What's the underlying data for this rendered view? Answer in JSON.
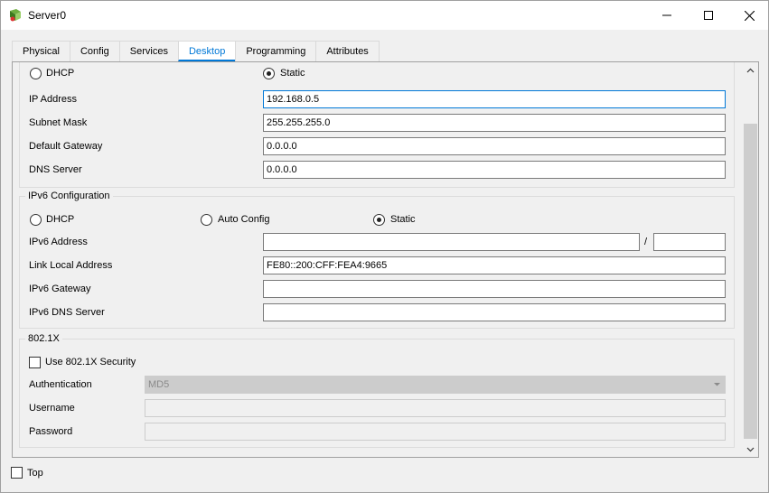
{
  "window": {
    "title": "Server0",
    "icon": "server-app-icon",
    "controls": [
      "minimize-icon",
      "maximize-icon",
      "close-icon"
    ]
  },
  "tabs": [
    {
      "label": "Physical",
      "active": false
    },
    {
      "label": "Config",
      "active": false
    },
    {
      "label": "Services",
      "active": false
    },
    {
      "label": "Desktop",
      "active": true
    },
    {
      "label": "Programming",
      "active": false
    },
    {
      "label": "Attributes",
      "active": false
    }
  ],
  "ipv4": {
    "dhcp_label": "DHCP",
    "static_label": "Static",
    "mode": "Static",
    "ip_address_label": "IP Address",
    "ip_address": "192.168.0.5",
    "subnet_label": "Subnet Mask",
    "subnet": "255.255.255.0",
    "gateway_label": "Default Gateway",
    "gateway": "0.0.0.0",
    "dns_label": "DNS Server",
    "dns": "0.0.0.0"
  },
  "ipv6": {
    "group_label": "IPv6 Configuration",
    "dhcp_label": "DHCP",
    "auto_label": "Auto Config",
    "static_label": "Static",
    "mode": "Static",
    "address_label": "IPv6 Address",
    "address": "",
    "slash": "/",
    "prefix": "",
    "link_local_label": "Link Local Address",
    "link_local": "FE80::200:CFF:FEA4:9665",
    "gateway_label": "IPv6 Gateway",
    "gateway": "",
    "dns_label": "IPv6 DNS Server",
    "dns": ""
  },
  "dot1x": {
    "group_label": "802.1X",
    "use_security_label": "Use 802.1X Security",
    "use_security": false,
    "auth_label": "Authentication",
    "auth_value": "MD5",
    "username_label": "Username",
    "username": "",
    "password_label": "Password",
    "password": ""
  },
  "footer": {
    "top_label": "Top",
    "top_checked": false
  }
}
